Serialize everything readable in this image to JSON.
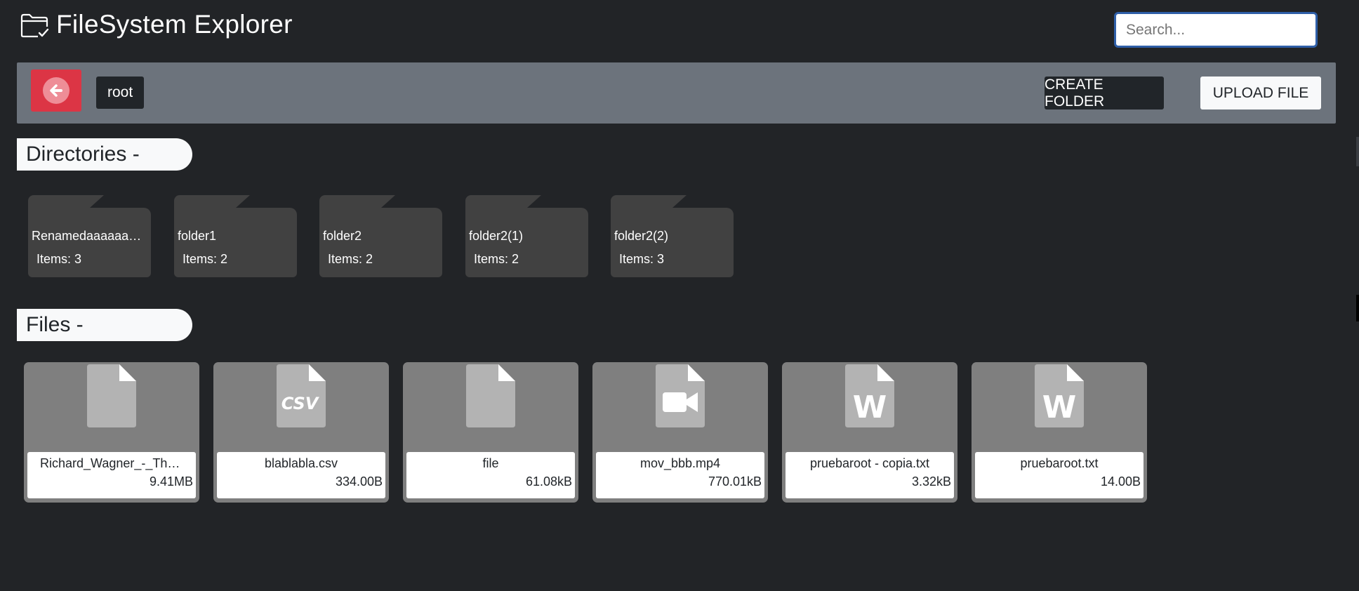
{
  "header": {
    "title": "FileSystem Explorer",
    "title_icon": "folder-check-icon",
    "search_placeholder": "Search..."
  },
  "toolbar": {
    "back_icon": "arrow-left-circle-icon",
    "breadcrumb": "root",
    "create_folder_label": "CREATE FOLDER",
    "upload_file_label": "UPLOAD FILE"
  },
  "directories": {
    "heading": "Directories -",
    "items": [
      {
        "name": "Renamedaaaaaaaaa",
        "count": "Items: 3"
      },
      {
        "name": "folder1",
        "count": "Items: 2"
      },
      {
        "name": "folder2",
        "count": "Items: 2"
      },
      {
        "name": "folder2(1)",
        "count": "Items: 2"
      },
      {
        "name": "folder2(2)",
        "count": "Items: 3"
      }
    ]
  },
  "files": {
    "heading": "Files -",
    "items": [
      {
        "name": "Richard_Wagner_-_The_Ride",
        "size": "9.41MB",
        "icon": "file-icon"
      },
      {
        "name": "blablabla.csv",
        "size": "334.00B",
        "icon": "file-csv-icon"
      },
      {
        "name": "file",
        "size": "61.08kB",
        "icon": "file-icon"
      },
      {
        "name": "mov_bbb.mp4",
        "size": "770.01kB",
        "icon": "file-video-icon"
      },
      {
        "name": "pruebaroot - copia.txt",
        "size": "3.32kB",
        "icon": "file-word-icon"
      },
      {
        "name": "pruebaroot.txt",
        "size": "14.00B",
        "icon": "file-word-icon"
      }
    ]
  },
  "colors": {
    "background": "#222427",
    "toolbar": "#6c737c",
    "danger": "#dc3545",
    "folder": "#414141",
    "file_card": "#7f7f7f"
  }
}
